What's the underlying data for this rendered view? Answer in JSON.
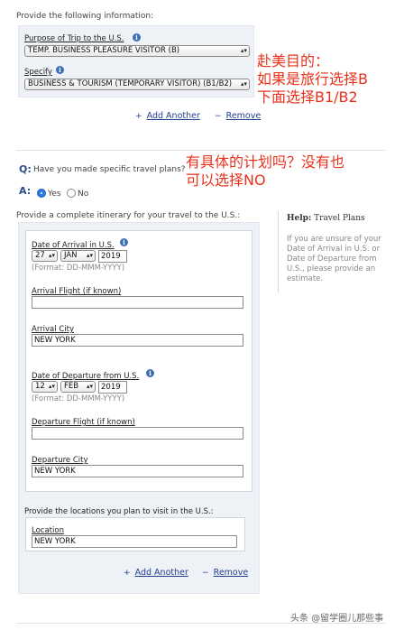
{
  "section1": {
    "intro": "Provide the following information:",
    "purpose_label": "Purpose of Trip to the U.S.",
    "purpose_value": "TEMP. BUSINESS PLEASURE VISITOR (B)",
    "specify_label": "Specify",
    "specify_value": "BUSINESS & TOURISM (TEMPORARY VISITOR) (B1/B2)",
    "add_another": "Add Another",
    "remove": "Remove"
  },
  "annotation1": {
    "line1": "赴美目的：",
    "line2": "如果是旅行选择B",
    "line3": "下面选择B1/B2"
  },
  "question": {
    "q_marker": "Q:",
    "q_text": "Have you made specific travel plans?",
    "a_marker": "A:",
    "yes": "Yes",
    "no": "No"
  },
  "annotation2": {
    "line1": "有具体的计划吗？没有也",
    "line2": "可以选择NO"
  },
  "itinerary": {
    "intro": "Provide a complete itinerary for your travel to the U.S.:",
    "arrival_date_label": "Date of Arrival in U.S.",
    "arrival_day": "27",
    "arrival_month": "JAN",
    "arrival_year": "2019",
    "format_hint": "(Format: DD-MMM-YYYY)",
    "arrival_flight_label": "Arrival Flight (if known)",
    "arrival_flight_value": "",
    "arrival_city_label": "Arrival City",
    "arrival_city_value": "NEW YORK",
    "departure_date_label": "Date of Departure from U.S.",
    "departure_day": "12",
    "departure_month": "FEB",
    "departure_year": "2019",
    "departure_format_hint": "(Format: DD-MMM-YYYY)",
    "departure_flight_label": "Departure Flight (if known)",
    "departure_flight_value": "",
    "departure_city_label": "Departure City",
    "departure_city_value": "NEW YORK"
  },
  "locations": {
    "intro": "Provide the locations you plan to visit in the U.S.:",
    "location_label": "Location",
    "location_value": "NEW YORK",
    "add_another": "Add Another",
    "remove": "Remove"
  },
  "help": {
    "label": "Help:",
    "title": "Travel Plans",
    "body": "If you are unsure of your Date of Arrival in U.S. or Date of Departure from U.S., please provide an estimate."
  },
  "watermark": "头条 @留学圈儿那些事",
  "colors": {
    "accent": "#2b4c8e",
    "annotation": "#e8321c",
    "panel": "#eef1f6"
  }
}
